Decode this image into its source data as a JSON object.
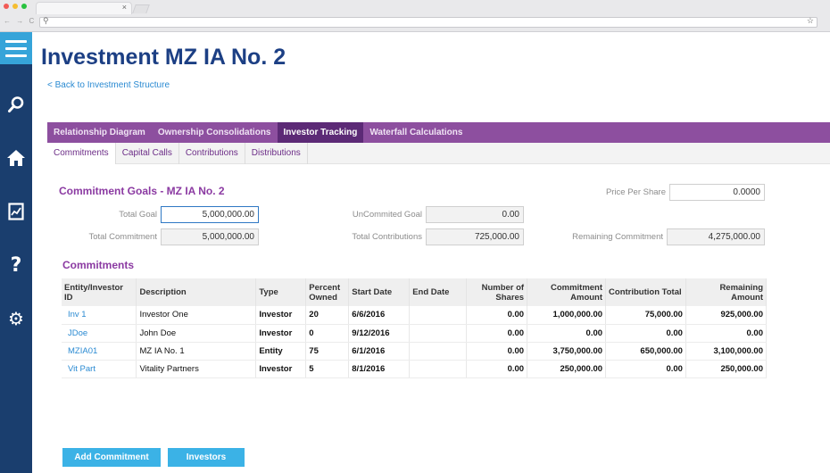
{
  "page": {
    "title": "Investment MZ IA No. 2",
    "back_link": "< Back to Investment Structure"
  },
  "tabs_primary": [
    {
      "label": "Relationship Diagram",
      "active": false
    },
    {
      "label": "Ownership Consolidations",
      "active": false
    },
    {
      "label": "Investor Tracking",
      "active": true
    },
    {
      "label": "Waterfall Calculations",
      "active": false
    }
  ],
  "tabs_secondary": [
    {
      "label": "Commitments",
      "active": true
    },
    {
      "label": "Capital Calls",
      "active": false
    },
    {
      "label": "Contributions",
      "active": false
    },
    {
      "label": "Distributions",
      "active": false
    }
  ],
  "goals": {
    "title": "Commitment Goals - MZ IA No. 2",
    "price_per_share_label": "Price Per Share",
    "price_per_share": "0.0000",
    "total_goal_label": "Total Goal",
    "total_goal": "5,000,000.00",
    "uncommitted_goal_label": "UnCommited Goal",
    "uncommitted_goal": "0.00",
    "total_commitment_label": "Total Commitment",
    "total_commitment": "5,000,000.00",
    "total_contributions_label": "Total Contributions",
    "total_contributions": "725,000.00",
    "remaining_commitment_label": "Remaining Commitment",
    "remaining_commitment": "4,275,000.00"
  },
  "commitments": {
    "title": "Commitments",
    "columns": [
      "Entity/Investor ID",
      "Description",
      "Type",
      "Percent Owned",
      "Start Date",
      "End Date",
      "Number of Shares",
      "Commitment Amount",
      "Contribution Total",
      "Remaining Amount"
    ],
    "rows": [
      [
        "Inv 1",
        "Investor One",
        "Investor",
        "20",
        "6/6/2016",
        "",
        "0.00",
        "1,000,000.00",
        "75,000.00",
        "925,000.00"
      ],
      [
        "JDoe",
        "John Doe",
        "Investor",
        "0",
        "9/12/2016",
        "",
        "0.00",
        "0.00",
        "0.00",
        "0.00"
      ],
      [
        "MZIA01",
        "MZ IA No. 1",
        "Entity",
        "75",
        "6/1/2016",
        "",
        "0.00",
        "3,750,000.00",
        "650,000.00",
        "3,100,000.00"
      ],
      [
        "Vit Part",
        "Vitality Partners",
        "Investor",
        "5",
        "8/1/2016",
        "",
        "0.00",
        "250,000.00",
        "0.00",
        "250,000.00"
      ]
    ]
  },
  "buttons": {
    "add_commitment": "Add Commitment",
    "investors": "Investors"
  },
  "colors": {
    "sidebar": "#1a3e6e",
    "sidebar_active": "#36a4d9",
    "title": "#1c3f84",
    "tab_purple": "#8d4f9f",
    "tab_active": "#5c2a76",
    "accent_purple": "#8b3aa2",
    "link_blue": "#2a8ad2",
    "button_blue": "#3bb2e6"
  },
  "icons": {
    "sidebar": [
      "menu-icon",
      "search-icon",
      "home-icon",
      "report-icon",
      "help-icon",
      "gear-icon"
    ]
  }
}
